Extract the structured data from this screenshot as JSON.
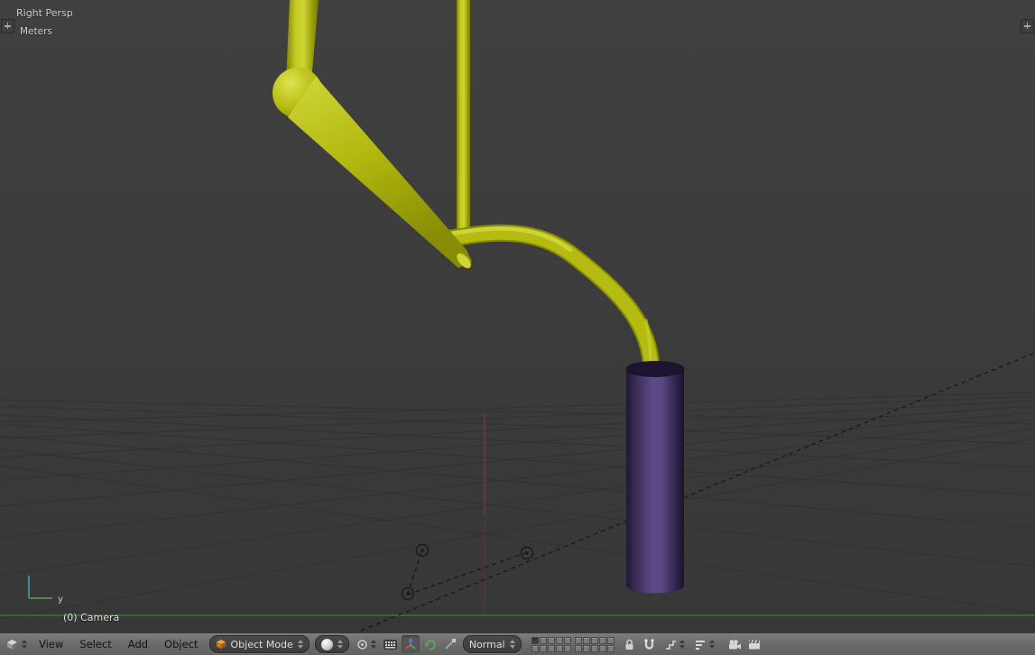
{
  "viewport": {
    "view_label": "Right Persp",
    "unit_label": "Meters",
    "active_object_info": "(0) Camera",
    "axis_label_y": "y"
  },
  "header": {
    "editor_type": "3d-view",
    "menus": [
      {
        "label": "View"
      },
      {
        "label": "Select"
      },
      {
        "label": "Add"
      },
      {
        "label": "Object"
      }
    ],
    "mode": {
      "label": "Object Mode"
    },
    "orientation": {
      "label": "Normal"
    },
    "layers": {
      "groups": 2,
      "per_group": 10,
      "active_index": 0
    },
    "icons": [
      "editor-3d-view-icon",
      "dropdown-arrows-icon",
      "object-mode-cube-icon",
      "shading-sphere-icon",
      "pivot-point-icon",
      "manipulator-grid-icon",
      "translate-manipulator-icon",
      "rotate-manipulator-icon",
      "scale-manipulator-icon",
      "lock-icon",
      "magnet-icon",
      "snap-element-icon",
      "snap-target-icon",
      "camera-icon",
      "clapper-icon"
    ]
  },
  "colors": {
    "viewport_bg": "#3b3b3b",
    "header_bg": "#6e6e6e",
    "object_yellow": "#b5bb11",
    "object_yellow_light": "#d2d83c",
    "object_yellow_dark": "#878c04",
    "object_purple": "#5d4a86",
    "grid_line": "#313131",
    "axis_red": "#7e3a3a",
    "axis_green": "#3f8a3f"
  }
}
